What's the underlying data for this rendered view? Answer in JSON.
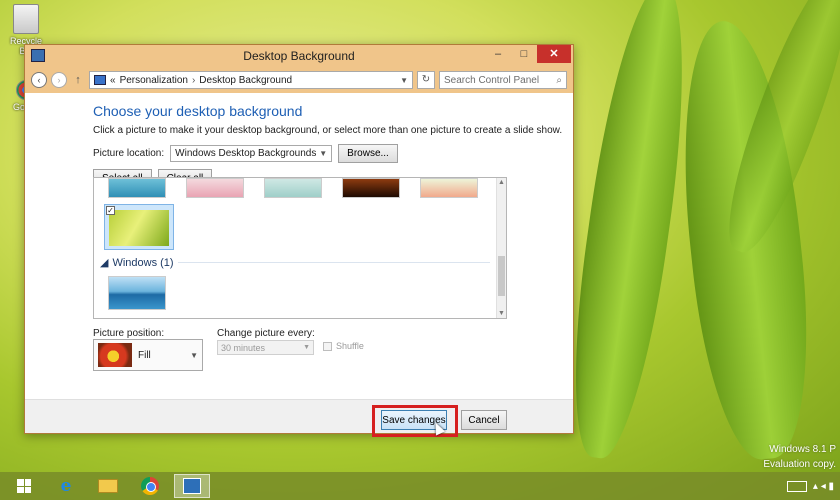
{
  "desktop": {
    "recycle_bin_label": "Recycle Bin",
    "icon2_label": "Go Ch"
  },
  "window": {
    "title": "Desktop Background",
    "controls": {
      "minimize": "–",
      "maximize": "□",
      "close": "✕"
    }
  },
  "nav": {
    "back": "‹",
    "forward": "›",
    "up": "↑",
    "breadcrumb_prefix": "«",
    "breadcrumbs": [
      "Personalization",
      "Desktop Background"
    ],
    "crumb_separator": "›",
    "refresh": "↻",
    "search_placeholder": "Search Control Panel",
    "search_icon": "⌕"
  },
  "content": {
    "heading": "Choose your desktop background",
    "instructions": "Click a picture to make it your desktop background, or select more than one picture to create a slide show.",
    "picture_location_label": "Picture location:",
    "picture_location_value": "Windows Desktop Backgrounds",
    "browse_label": "Browse...",
    "select_all_label": "Select all",
    "clear_all_label": "Clear all",
    "group_header": "Windows (1)",
    "group_toggle": "◢",
    "selected_check": "✓",
    "picture_position_label": "Picture position:",
    "picture_position_value": "Fill",
    "change_every_label": "Change picture every:",
    "change_every_value": "30 minutes",
    "shuffle_label": "Shuffle"
  },
  "footer": {
    "save_label": "Save changes",
    "cancel_label": "Cancel"
  },
  "watermark": {
    "line1": "Windows 8.1 P",
    "line2": "Evaluation copy."
  },
  "taskbar": {
    "ie_glyph": "e",
    "tray_glyph": "▴ ◂ ▮"
  },
  "colors": {
    "heading": "#1e5fb4",
    "titlebar": "#f0c58a",
    "highlight": "#d6201f",
    "close_button": "#c7302b"
  },
  "icons": [
    "recycle-bin-icon",
    "control-panel-icon",
    "search-icon",
    "refresh-icon",
    "windows-start-icon",
    "internet-explorer-icon",
    "file-explorer-icon",
    "chrome-icon",
    "keyboard-icon"
  ]
}
